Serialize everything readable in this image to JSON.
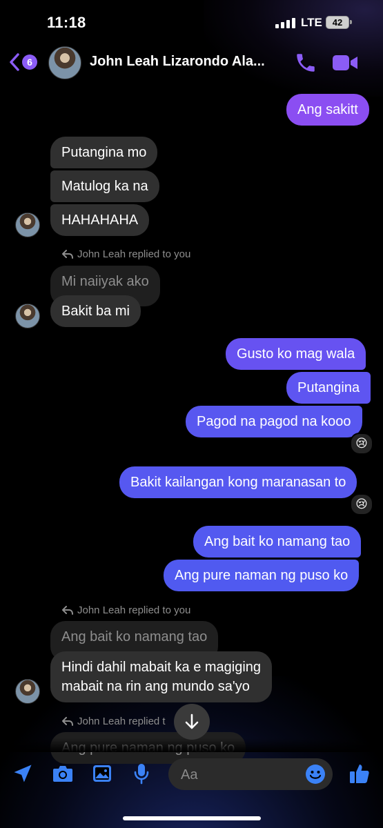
{
  "status_bar": {
    "time": "11:18",
    "network": "LTE",
    "battery": "42"
  },
  "header": {
    "back_count": "6",
    "contact_name": "John Leah Lizarondo Ala..."
  },
  "messages": {
    "m1": "Ang sakitt",
    "m2": "Putangina mo",
    "m3": "Matulog ka na",
    "m4": "HAHAHAHA",
    "reply1_label": "John Leah replied to you",
    "reply1_quote": "Mi naiiyak ako",
    "m5": "Bakit ba mi",
    "m6": "Gusto ko mag wala",
    "m7": "Putangina",
    "m8": "Pagod na pagod na kooo",
    "m8_reaction": "😢",
    "m9": "Bakit kailangan kong maranasan to",
    "m9_reaction": "😢",
    "m10": "Ang bait ko namang tao",
    "m11": "Ang pure naman ng puso ko",
    "reply2_label": "John Leah replied to you",
    "reply2_quote": "Ang bait ko namang tao",
    "m12_line1": "Hindi dahil mabait ka e magiging",
    "m12_line2": "mabait na rin ang mundo sa'yo",
    "reply3_label": "John Leah replied t",
    "reply3_quote": "Ang pure naman ng puso ko"
  },
  "composer": {
    "placeholder": "Aa"
  },
  "colors": {
    "accent": "#8b5cf6",
    "outgoing_gradient_top": "#8b4ef2",
    "outgoing_gradient_bottom": "#4f5af0",
    "incoming": "#303030"
  },
  "icons": [
    "chevron-left-icon",
    "phone-icon",
    "video-camera-icon",
    "location-arrow-icon",
    "camera-icon",
    "image-icon",
    "microphone-icon",
    "emoji-icon",
    "thumbs-up-icon",
    "arrow-down-icon",
    "reply-icon"
  ]
}
